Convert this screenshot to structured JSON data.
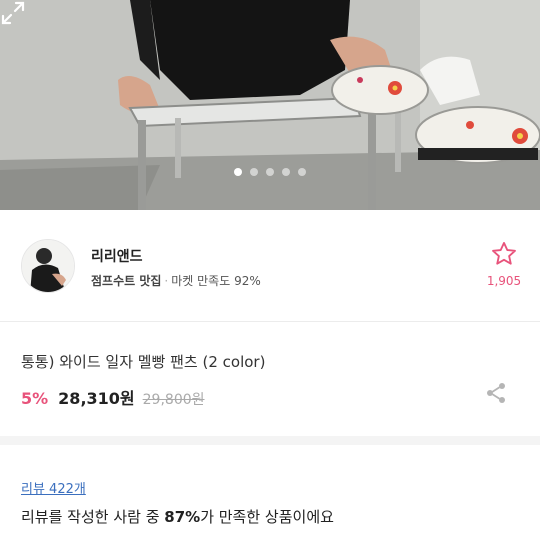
{
  "hero": {
    "image_alt": "product photo",
    "slide_count": 5,
    "active_slide": 1
  },
  "seller": {
    "name": "리리앤드",
    "tag": "점프수트 맛집",
    "separator": "·",
    "satisfaction_label": "마켓 만족도 92%",
    "favorite_count": "1,905"
  },
  "product": {
    "title": "통통) 와이드 일자 멜빵 팬츠 (2 color)",
    "discount": "5%",
    "price": "28,310원",
    "original_price": "29,800원"
  },
  "review": {
    "link": "리뷰 422개",
    "text_before": "리뷰를 작성한 사람 중 ",
    "percent": "87%",
    "text_after": "가 만족한 상품이에요"
  },
  "colors": {
    "accent_pink": "#e8537b",
    "link_blue": "#3b6fbe"
  },
  "icons": [
    "expand-icon",
    "star-outline-icon",
    "share-icon"
  ]
}
